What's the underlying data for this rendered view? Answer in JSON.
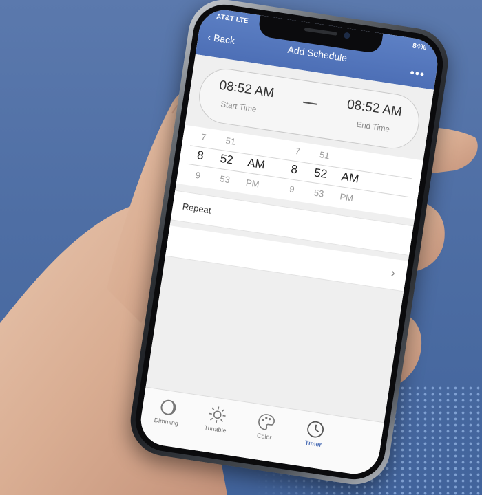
{
  "status_bar": {
    "carrier": "AT&T LTE",
    "battery": "84%"
  },
  "header": {
    "back_label": "Back",
    "title": "Add Schedule",
    "more_label": "•••"
  },
  "times": {
    "start_value": "08:52 AM",
    "start_label": "Start Time",
    "end_value": "08:52 AM",
    "end_label": "End Time"
  },
  "picker": {
    "start": {
      "hour_above": "7",
      "hour": "8",
      "hour_below": "9",
      "min_above": "51",
      "min": "52",
      "min_below": "53",
      "ampm": "AM",
      "ampm_below": "PM"
    },
    "end": {
      "hour_above": "7",
      "hour": "8",
      "hour_below": "9",
      "min_above": "51",
      "min": "52",
      "min_below": "53",
      "ampm": "AM",
      "ampm_below": "PM"
    }
  },
  "repeat": {
    "label": "Repeat",
    "chevron": "›"
  },
  "tabs": [
    {
      "label": "Dimming",
      "icon": "dimming-icon"
    },
    {
      "label": "Tunable",
      "icon": "sun-icon"
    },
    {
      "label": "Color",
      "icon": "palette-icon"
    },
    {
      "label": "Timer",
      "icon": "clock-icon"
    }
  ],
  "colors": {
    "header": "#4d6fb6",
    "background": "#5b79ad",
    "active_tab": "#4d6fb6"
  }
}
